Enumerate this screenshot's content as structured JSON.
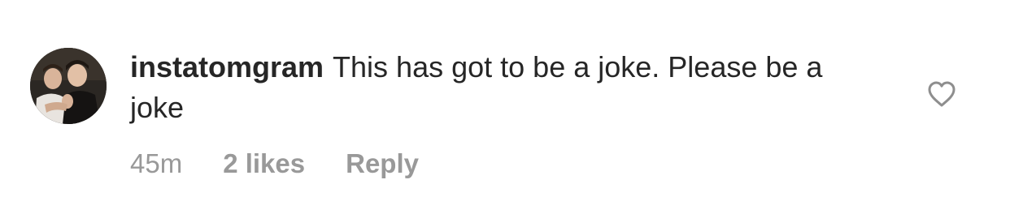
{
  "comment": {
    "avatar_icon": "user-avatar-photo",
    "username": "instatomgram",
    "text": "This has got to be a joke. Please be a joke",
    "timestamp": "45m",
    "likes": "2 likes",
    "reply_label": "Reply",
    "like_icon": "heart-outline-icon"
  },
  "colors": {
    "text": "#262626",
    "meta": "#999999",
    "heart_stroke": "#8e8e8e",
    "background": "#ffffff"
  }
}
